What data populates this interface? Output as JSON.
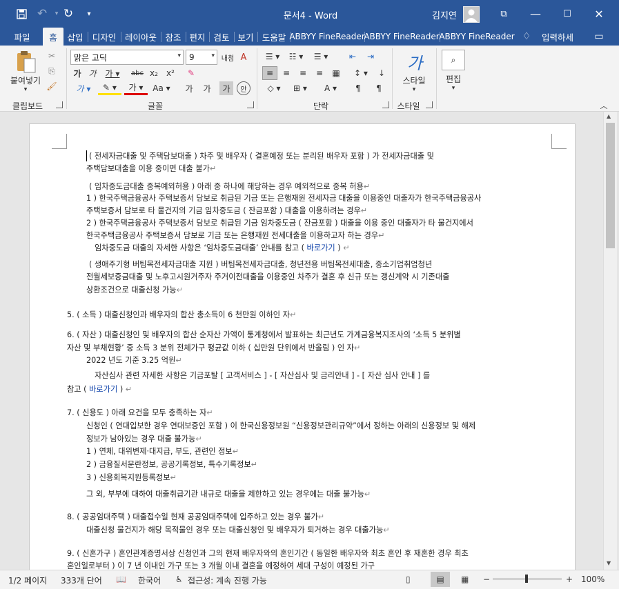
{
  "window": {
    "doc_title": "문서4  -  Word",
    "user_name": "김지연"
  },
  "tabs": [
    "파일",
    "홈",
    "삽입",
    "디자인",
    "레이아웃",
    "참조",
    "편지",
    "검토",
    "보기",
    "도움말",
    "ABBYY FineReader",
    "ABBYY FineReader",
    "ABBYY FineReader",
    "입력하세"
  ],
  "ribbon": {
    "clipboard": {
      "paste_label": "붙여넣기",
      "group_label": "클립보드"
    },
    "font": {
      "font_name": "맑은 고딕",
      "font_size": "9",
      "group_label": "글꼴"
    },
    "paragraph": {
      "group_label": "단락"
    },
    "styles": {
      "style_label": "스타일",
      "group_label": "스타일"
    },
    "editing": {
      "label": "편집"
    }
  },
  "document": {
    "lines": [
      "( 전세자금대출 및 주택담보대출 )  차주 및 배우자 ( 결혼예정 또는 분리된 배우자 포함 ) 가 전세자금대출 및",
      "주택담보대출을 이용 중이면 대출 불가",
      "( 임차중도금대출 중복예외허용 )  아래 중 하나에 해당하는 경우 예외적으로 중복 허용",
      "1 )  한국주택금융공사 주택보증서 담보로 취급된 기금 또는 은행재원 전세자금 대출을 이용중인 대출자가 한국주택금융공사",
      "주택보증서 담보로 타 물건지의 기금 임차중도금 ( 잔금포함 )  대출을 이용하려는 경우",
      "2 )  한국주택금융공사 주택보증서 담보로 취급된 기금 임차중도금 ( 잔금포함 )  대출을 이용 중인 대출자가 타 물건지에서",
      "한국주택금융공사 주택보증서 담보로 기금 또는 은행재원 전세대출을 이용하고자 하는 경우",
      "임차중도금 대출의 자세한 사항은 ‘임차중도금대출’ 안내를 참고 (",
      "바로가기",
      ")",
      "( 생애주기형 버팀목전세자금대출 지원 )  버팀목전세자금대출, 청년전용 버팀목전세대출, 중소기업취업청년",
      "전월세보증금대출 및 노후고시원거주자 주거이전대출을 이용중인 차주가 결혼 후 신규 또는 갱신계약 시 기존대출",
      "상환조건으로 대출신청 가능",
      "5.    ( 소득 )  대출신청인과 배우자의 합산 총소득이 6 천만원 이하인 자",
      "6.    ( 자산 )  대출신청인 및 배우자의 합산 순자산 가액이 통계청에서 발표하는 최근년도 가계금융복지조사의 ‘소득 5 분위별",
      "자산 및 부채현황’ 중 소득 3 분위 전체가구 평균값 이하 ( 십만원 단위에서 반올림 ) 인 자",
      "2022 년도 기준 3.25 억원",
      "자산심사 관련 자세한 사항은 기금포탈  [ 고객서비스 ] - [ 자산심사 및 금리안내 ] - [ 자산 심사 안내 ] 를",
      "참고 (",
      "바로가기",
      ")",
      "7.    ( 신용도 )  아래 요건을 모두 충족하는 자",
      "신청인 ( 연대입보한 경우 연대보증인 포함 ) 이 한국신용정보원 “신용정보관리규약”에서 정하는 아래의 신용정보 및 해제",
      "정보가 남아있는 경우 대출 불가능",
      "1 )  연체, 대위변제·대지급, 부도, 관련인 정보",
      "2 )  금융질서문란정보, 공공기록정보, 특수기록정보",
      "3 )  신용회복지원등록정보",
      "그 외, 부부에 대하여 대출취급기관 내규로 대출을 제한하고 있는 경우에는 대출 불가능",
      "8.    ( 공공임대주택 )  대출접수일 현재 공공임대주택에 입주하고 있는 경우 불가",
      "대출신청 물건지가 해당 목적물인 경우 또는 대출신청인 및 배우자가 퇴거하는 경우 대출가능",
      "9.    ( 신혼가구 )  혼인관계증명서상 신청인과 그의 현재 배우자와의 혼인기간 ( 동일한 배우자와 최초 혼인 후 재혼한 경우 최초",
      "혼인일로부터 ) 이 7 년 이내인 가구 또는 3 개월 이내 결혼을 예정하여 세대 구성이 예정된 가구"
    ]
  },
  "status": {
    "page": "1/2 페이지",
    "words": "333개 단어",
    "language": "한국어",
    "accessibility": "접근성: 계속 진행 가능",
    "zoom": "100%",
    "zoom_level": 1.0
  },
  "colors": {
    "accent": "#2b579a",
    "link": "#0b3fa8"
  }
}
